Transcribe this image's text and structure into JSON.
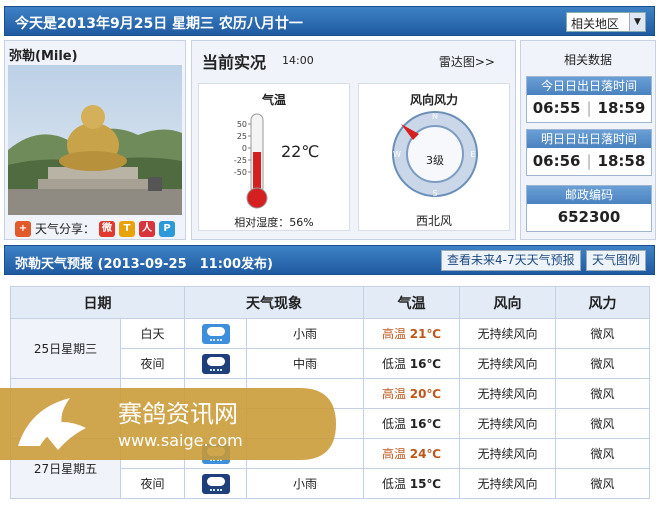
{
  "header": {
    "date_line": "今天是2013年9月25日 星期三 农历八月廿一",
    "region_select": "相关地区"
  },
  "city": {
    "name": "弥勒(Mile)",
    "share_label": "天气分享："
  },
  "current": {
    "title": "当前实况",
    "time": "14:00",
    "radar_link": "雷达图>>",
    "temp_card_title": "气温",
    "temp_value": "22℃",
    "thermo_ticks": [
      "50",
      "25",
      "0",
      "-25",
      "-50"
    ],
    "humidity": "相对湿度：56%",
    "wind_card_title": "风向风力",
    "wind_level": "3级",
    "wind_dir": "西北风",
    "compass": [
      "N",
      "E",
      "S",
      "W"
    ]
  },
  "related": {
    "title": "相关数据",
    "today_label": "今日日出日落时间",
    "today_rise": "06:55",
    "today_set": "18:59",
    "tomorrow_label": "明日日出日落时间",
    "tomorrow_rise": "06:56",
    "tomorrow_set": "18:58",
    "postcode_label": "邮政编码",
    "postcode": "652300"
  },
  "forecast": {
    "title": "弥勒天气预报 (2013-09-25　11:00发布)",
    "btn_4_7": "查看未来4-7天天气预报",
    "btn_legend": "天气图例",
    "headers": [
      "日期",
      "天气现象",
      "气温",
      "风向",
      "风力"
    ],
    "rows": [
      {
        "date": "25日星期三",
        "period": "白天",
        "weather": "小雨",
        "tlabel": "高温",
        "temp": "21℃",
        "wind_dir": "无持续风向",
        "wind_force": "微风"
      },
      {
        "date": "",
        "period": "夜间",
        "weather": "中雨",
        "tlabel": "低温",
        "temp": "16℃",
        "wind_dir": "无持续风向",
        "wind_force": "微风"
      },
      {
        "date": "",
        "period": "",
        "weather": "",
        "tlabel": "高温",
        "temp": "20℃",
        "wind_dir": "无持续风向",
        "wind_force": "微风"
      },
      {
        "date": "",
        "period": "",
        "weather": "",
        "tlabel": "低温",
        "temp": "16℃",
        "wind_dir": "无持续风向",
        "wind_force": "微风"
      },
      {
        "date": "27日星期五",
        "period": "",
        "weather": "",
        "tlabel": "高温",
        "temp": "24℃",
        "wind_dir": "无持续风向",
        "wind_force": "微风"
      },
      {
        "date": "",
        "period": "夜间",
        "weather": "小雨",
        "tlabel": "低温",
        "temp": "15℃",
        "wind_dir": "无持续风向",
        "wind_force": "微风"
      }
    ]
  },
  "watermark": {
    "name": "赛鸽资讯网",
    "url": "www.saige.com"
  },
  "colors": {
    "header_blue": "#2a6cb4",
    "high_temp": "#c0561a",
    "panel_bg": "#f0f4fa"
  }
}
